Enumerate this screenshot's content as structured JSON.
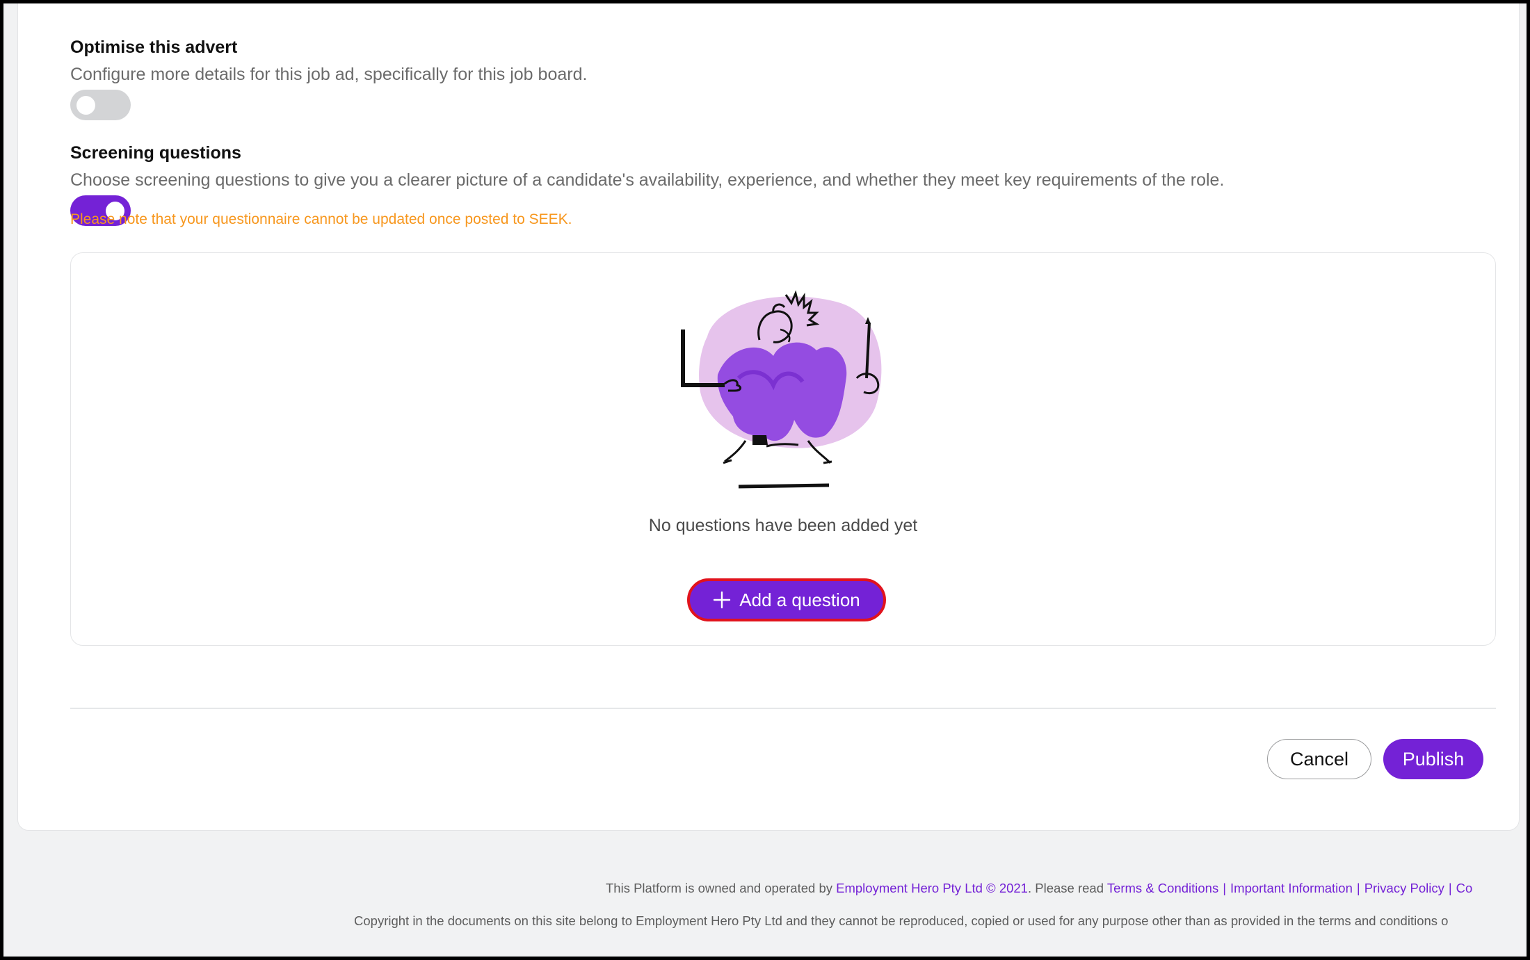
{
  "optimise": {
    "title": "Optimise this advert",
    "description": "Configure more details for this job ad, specifically for this job board.",
    "toggle_on": false
  },
  "screening": {
    "title": "Screening questions",
    "description": "Choose screening questions to give you a clearer picture of a candidate's availability, experience, and whether they meet key requirements of the role.",
    "toggle_on": true,
    "warning": "Please note that your questionnaire cannot be updated once posted to SEEK."
  },
  "questions_panel": {
    "empty_text": "No questions have been added yet",
    "add_button_label": "Add a question",
    "illustration": "person-multitasking-illustration"
  },
  "actions": {
    "cancel_label": "Cancel",
    "publish_label": "Publish"
  },
  "footer": {
    "line1_prefix": "This Platform is owned and operated by ",
    "company_link": "Employment Hero Pty Ltd © 2021",
    "line1_mid": ". Please read ",
    "links": [
      "Terms & Conditions",
      "Important Information",
      "Privacy Policy",
      "Co"
    ],
    "line2": "Copyright in the documents on this site belong to Employment Hero Pty Ltd and they cannot be reproduced, copied or used for any purpose other than as provided in the terms and conditions o"
  },
  "colors": {
    "accent": "#7422d6",
    "warning": "#f7971e",
    "focus_ring": "#e1131d",
    "illustration_pink": "#e6c3ec",
    "illustration_purple": "#8b3fe0"
  }
}
